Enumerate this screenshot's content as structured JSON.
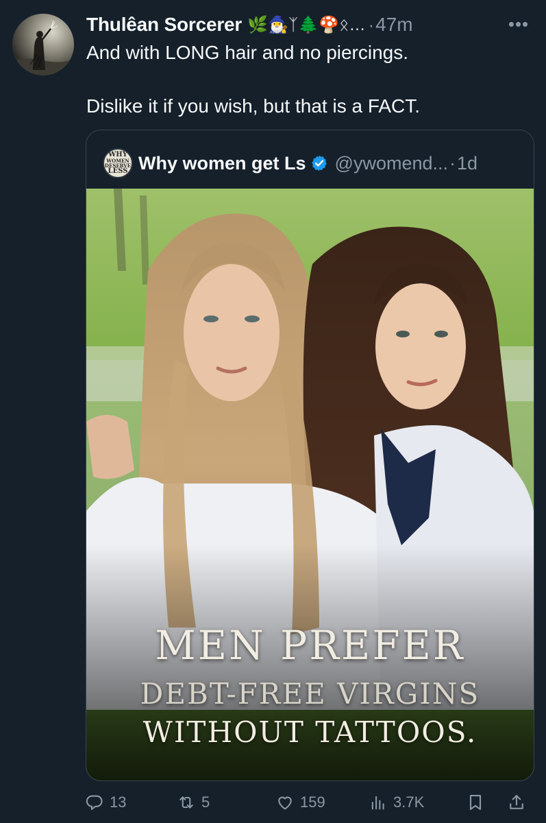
{
  "post": {
    "author": {
      "display_name": "Thulêan Sorcerer",
      "name_emojis": "🌿🧙‍♂️ᛉ🌲🍄ᛟ…",
      "separator": "·",
      "time": "47m"
    },
    "more_label": "•••",
    "text": {
      "line1": "And with LONG hair and no piercings.",
      "line2": "Dislike it if you wish, but that is a FACT."
    },
    "quote": {
      "avatar_text": {
        "l1": "WHY",
        "l2": "WOMEN",
        "l3": "DESERVE",
        "l4": "LESS"
      },
      "display_name": "Why women get Ls",
      "handle": "@ywomend...",
      "separator": "·",
      "time": "1d",
      "image_caption": {
        "line1": "MEN PREFER",
        "line2": "DEBT-FREE VIRGINS",
        "line3": "WITHOUT TATTOOS."
      }
    },
    "actions": {
      "reply_count": "13",
      "repost_count": "5",
      "like_count": "159",
      "views_count": "3.7K"
    }
  },
  "colors": {
    "background": "#15202b",
    "text_primary": "#f7f9f9",
    "text_secondary": "#8b98a5",
    "border": "#38444d",
    "verified": "#1d9bf0"
  },
  "icons": {
    "reply": "reply-icon",
    "repost": "repost-icon",
    "like": "heart-icon",
    "views": "views-chart-icon",
    "bookmark": "bookmark-icon",
    "share": "share-icon",
    "more": "more-dots-icon",
    "verified": "verified-badge-icon"
  }
}
